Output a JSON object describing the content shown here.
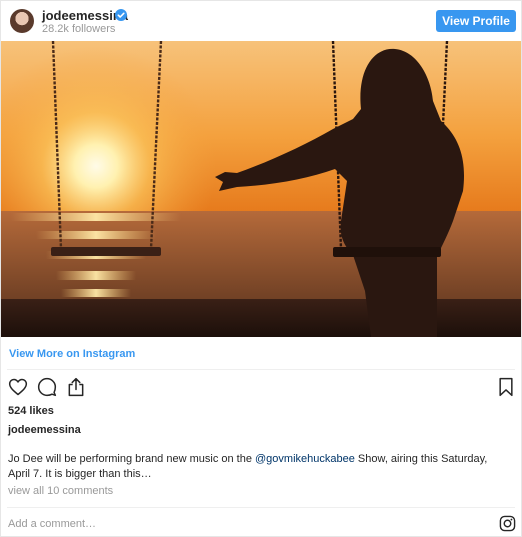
{
  "header": {
    "username": "jodeemessina",
    "followers": "28.2k followers",
    "view_profile": "View Profile"
  },
  "links": {
    "view_more": "View More on Instagram"
  },
  "post": {
    "likes": "524 likes",
    "poster": "jodeemessina",
    "caption_before": "Jo Dee will be performing brand new music on the ",
    "caption_mention": "@govmikehuckabee",
    "caption_after": " Show, airing this Saturday, April 7. It is bigger than this…",
    "view_comments": "view all 10 comments"
  },
  "comment": {
    "placeholder": "Add a comment…"
  },
  "icons": {
    "verified": "verified-badge-icon",
    "like": "heart-icon",
    "comment": "comment-icon",
    "share": "share-icon",
    "save": "bookmark-icon",
    "brand": "instagram-icon"
  },
  "colors": {
    "accent": "#3897f0",
    "mention": "#003569",
    "muted": "#999999",
    "text": "#262626"
  }
}
